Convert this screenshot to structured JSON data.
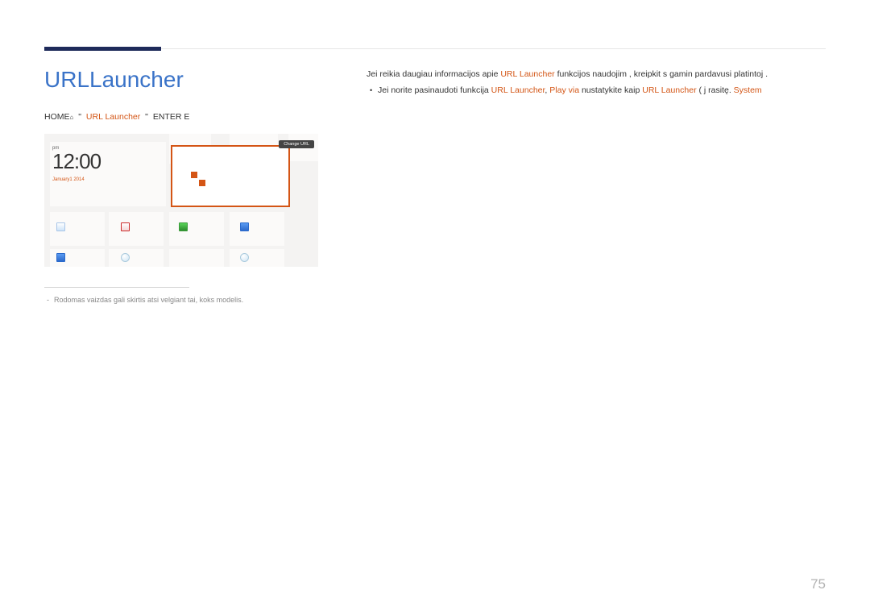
{
  "page_number": "75",
  "title": "URLLauncher",
  "nav": {
    "home": "HOME",
    "arrow": "\"",
    "url_launcher": "URL Launcher",
    "enter": "ENTER E"
  },
  "screenshot": {
    "meridiem": "pm",
    "time": "12:00",
    "date": "January1 2014",
    "change_url": "Change URL"
  },
  "caption": "Rodomas vaizdas gali skirtis atsi velgiant   tai, koks modelis.",
  "body": {
    "line1_a": "Jei reikia daugiau informacijos apie ",
    "line1_b": "URL Launcher",
    "line1_c": " funkcijos naudojim , kreipkit s   gamin  pardavusi platintoj .",
    "line2_a": "Jei norite pasinaudoti funkcija ",
    "line2_b": "URL Launcher",
    "line2_c": ", ",
    "line2_d": "Play via",
    "line2_e": " nustatykite kaip ",
    "line2_f": "URL Launcher",
    "line2_g": " ( j  rasitę. ",
    "line2_h": "System"
  }
}
